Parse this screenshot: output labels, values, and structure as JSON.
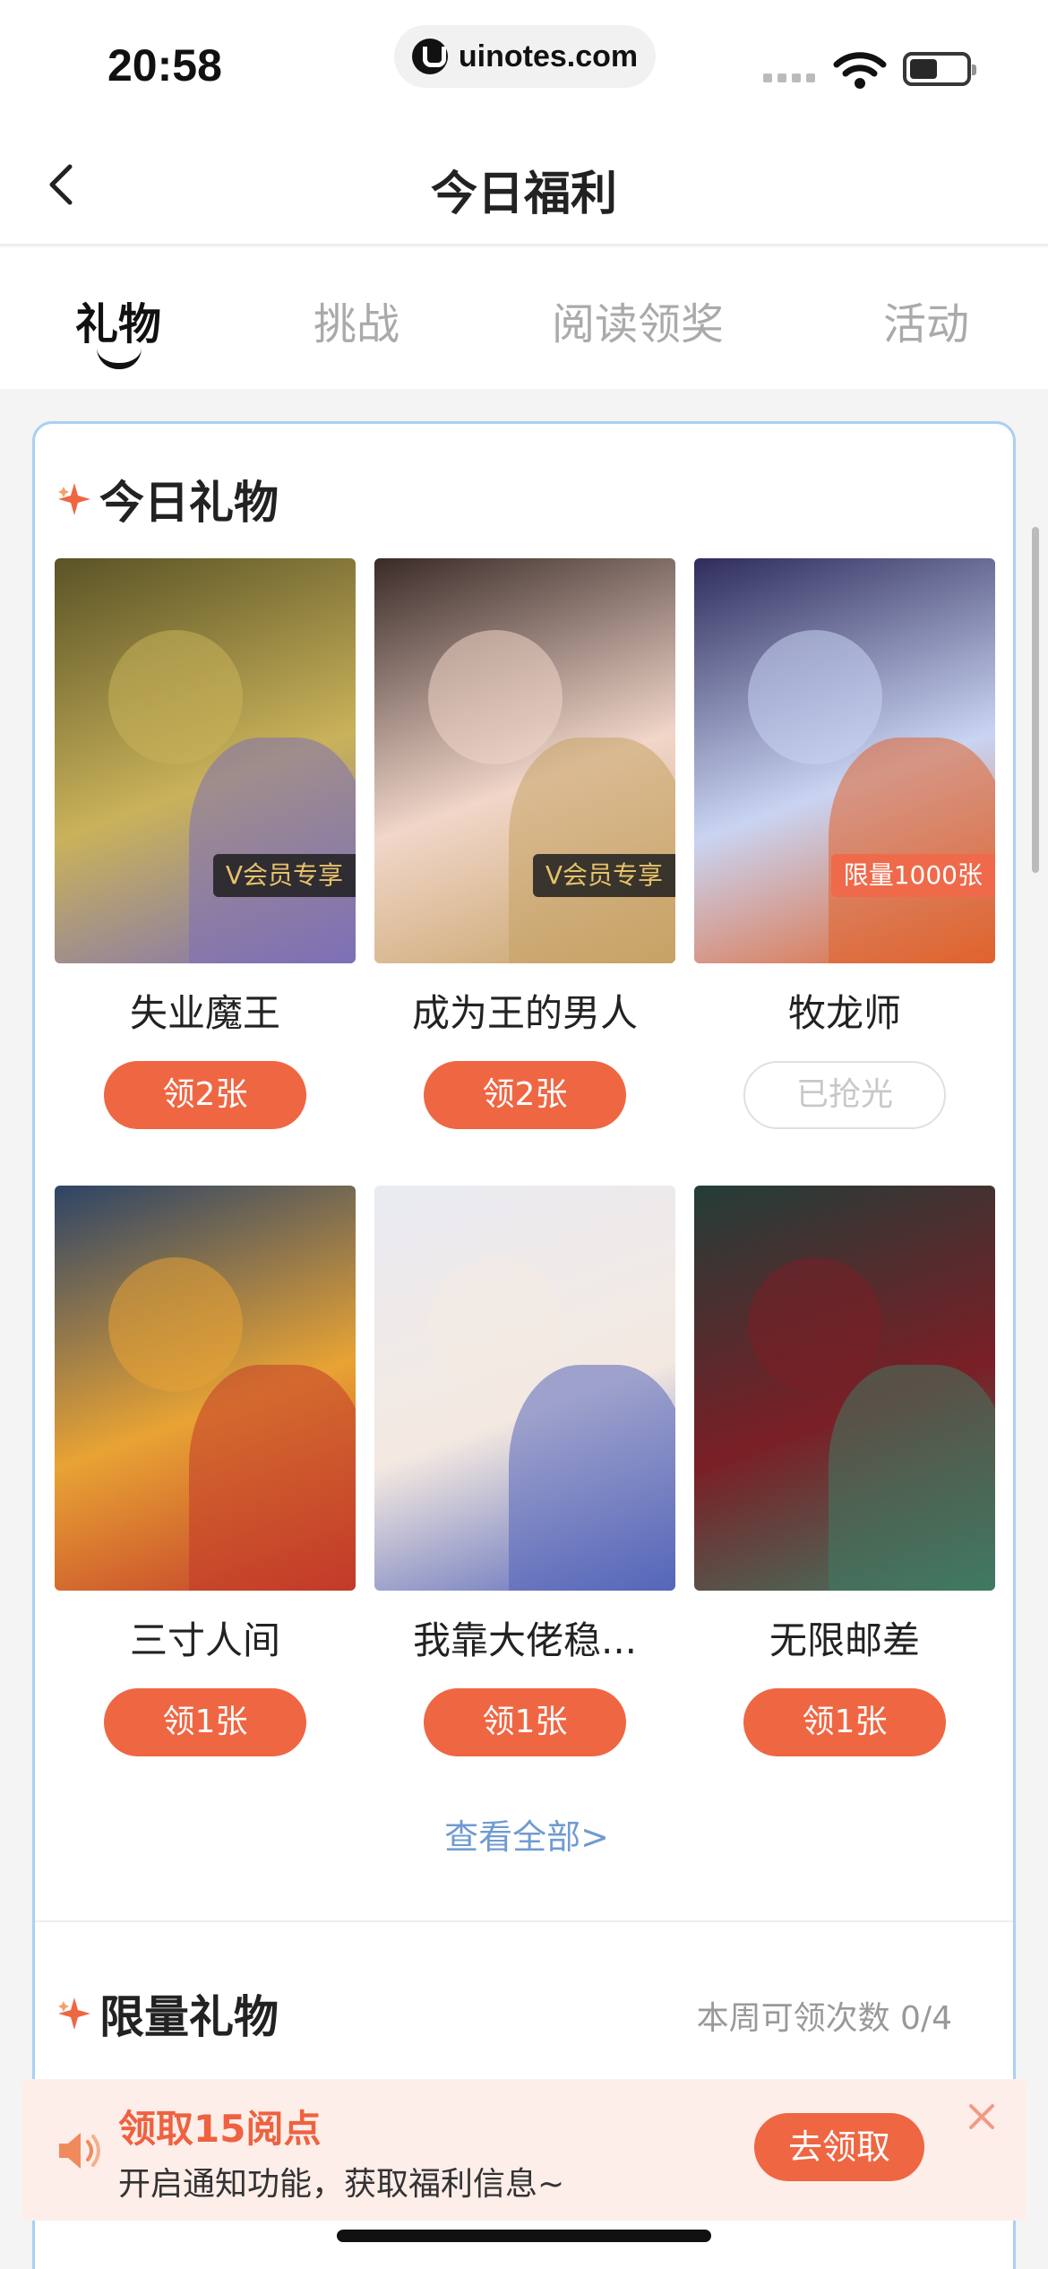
{
  "status_bar": {
    "time": "20:58",
    "url": "uinotes.com"
  },
  "nav": {
    "title": "今日福利",
    "back_icon": "chevron-left-icon"
  },
  "tabs": [
    {
      "label": "礼物",
      "active": true
    },
    {
      "label": "挑战",
      "active": false
    },
    {
      "label": "阅读领奖",
      "active": false
    },
    {
      "label": "活动",
      "active": false
    }
  ],
  "today_gifts": {
    "title": "今日礼物",
    "items": [
      {
        "title": "失业魔王",
        "badge": "V会员专享",
        "button": "领2张",
        "available": true,
        "palette": [
          "#5a5326",
          "#c9b25a",
          "#7d70b7"
        ]
      },
      {
        "title": "成为王的男人",
        "badge": "V会员专享",
        "button": "领2张",
        "available": true,
        "palette": [
          "#3a2b28",
          "#f1d6c9",
          "#c6a265"
        ]
      },
      {
        "title": "牧龙师",
        "badge": "限量1000张",
        "button": "已抢光",
        "available": false,
        "palette": [
          "#2e2c5c",
          "#c9d4f2",
          "#e0632c"
        ]
      },
      {
        "title": "三寸人间",
        "badge": "",
        "button": "领1张",
        "available": true,
        "palette": [
          "#2d4466",
          "#e8a334",
          "#c23a2a"
        ]
      },
      {
        "title": "我靠大佬稳...",
        "badge": "",
        "button": "领1张",
        "available": true,
        "palette": [
          "#e9ebf2",
          "#f4e9e1",
          "#5566b9"
        ]
      },
      {
        "title": "无限邮差",
        "badge": "",
        "button": "领1张",
        "available": true,
        "palette": [
          "#233d38",
          "#7a1f26",
          "#3f7a63"
        ]
      }
    ],
    "see_all": "查看全部>"
  },
  "limited_gifts": {
    "title": "限量礼物",
    "weekly_count": "本周可领次数 0/4"
  },
  "banner": {
    "title": "领取15阅点",
    "subtitle": "开启通知功能，获取福利信息~",
    "button": "去领取"
  },
  "colors": {
    "accent": "#ef6643",
    "link": "#6f9bd1",
    "card_border": "#a9d0f3"
  }
}
